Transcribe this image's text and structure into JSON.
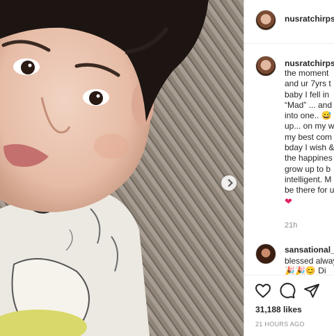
{
  "post": {
    "author": "nusratchirps",
    "caption_lines": [
      "the moment",
      "and ur 7yrs t",
      "baby I fell in",
      "“Mad” ... and",
      "into one..",
      "up... on my w",
      "my best com",
      "bday I wish &",
      "the happines",
      "grow up to b",
      "intelligent. M",
      "be there for u"
    ],
    "caption_emoji": "😅",
    "caption_heart": "❤",
    "caption_time": "21h",
    "likes": "31,188 likes",
    "posted_ago": "21 HOURS AGO"
  },
  "comment": {
    "author": "sansational_p",
    "text": "blessed alway",
    "emojis": "🎉🎉😊",
    "tail": "Di"
  },
  "colors": {
    "accent": "#262626",
    "muted": "#8e8e8e",
    "heart": "#ed4956",
    "border": "#dbdbdb"
  },
  "icons": [
    "heart-icon",
    "comment-icon",
    "share-icon",
    "chevron-right-icon"
  ]
}
